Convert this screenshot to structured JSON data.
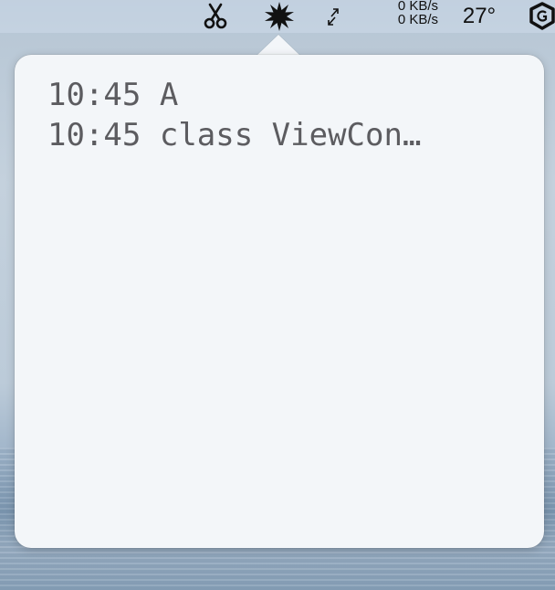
{
  "menubar": {
    "network": {
      "upload": "0 KB/s",
      "download": "0 KB/s"
    },
    "temperature": "27°",
    "icons": [
      "scissors-icon",
      "burst-icon",
      "expand-arrows-icon",
      "app-logo-icon"
    ]
  },
  "popover": {
    "items": [
      {
        "time": "10:45",
        "text": "A"
      },
      {
        "time": "10:45",
        "text": "class ViewCon…"
      }
    ]
  },
  "colors": {
    "popover_background": "#f3f6f9",
    "item_text": "#5c5c60",
    "menubar_icon": "#111111"
  }
}
